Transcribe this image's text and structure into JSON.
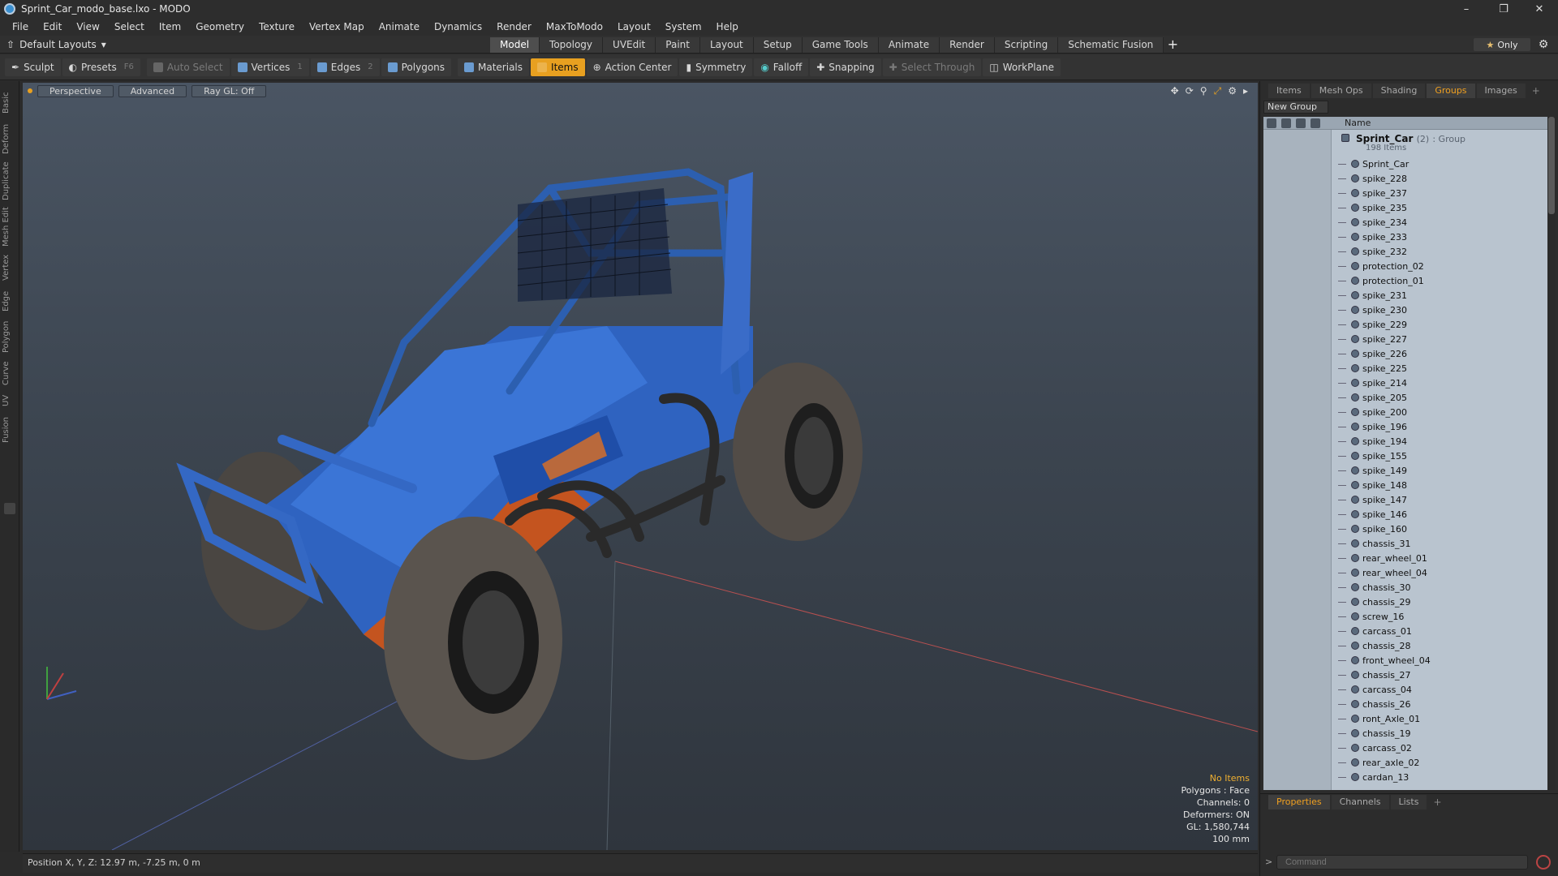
{
  "window": {
    "title": "Sprint_Car_modo_base.lxo - MODO"
  },
  "menu": [
    "File",
    "Edit",
    "View",
    "Select",
    "Item",
    "Geometry",
    "Texture",
    "Vertex Map",
    "Animate",
    "Dynamics",
    "Render",
    "MaxToModo",
    "Layout",
    "System",
    "Help"
  ],
  "layouts": {
    "current": "Default Layouts"
  },
  "layout_tabs": [
    "Model",
    "Topology",
    "UVEdit",
    "Paint",
    "Layout",
    "Setup",
    "Game Tools",
    "Animate",
    "Render",
    "Scripting",
    "Schematic Fusion"
  ],
  "layout_tab_active": "Model",
  "only_label": "Only",
  "toolbar": {
    "sculpt": "Sculpt",
    "presets": "Presets",
    "presets_key": "F6",
    "auto_select": "Auto Select",
    "vertices": "Vertices",
    "vertices_count": "1",
    "edges": "Edges",
    "edges_count": "2",
    "polygons": "Polygons",
    "materials": "Materials",
    "items": "Items",
    "action_center": "Action Center",
    "symmetry": "Symmetry",
    "falloff": "Falloff",
    "snapping": "Snapping",
    "select_through": "Select Through",
    "workplane": "WorkPlane"
  },
  "left_tabs": [
    "Basic",
    "Deform",
    "Duplicate",
    "Mesh Edit",
    "Vertex",
    "Edge",
    "Polygon",
    "Curve",
    "UV",
    "Fusion"
  ],
  "viewport": {
    "view": "Perspective",
    "mode": "Advanced",
    "raygl": "Ray GL: Off",
    "stats": {
      "selection": "No Items",
      "polygons": "Polygons : Face",
      "channels": "Channels: 0",
      "deformers": "Deformers: ON",
      "gl": "GL: 1,580,744",
      "scale": "100 mm"
    }
  },
  "status": {
    "position": "Position X, Y, Z:  12.97 m, -7.25 m, 0 m"
  },
  "right_panel": {
    "tabs": [
      "Items",
      "Mesh Ops",
      "Shading",
      "Groups",
      "Images"
    ],
    "active_tab": "Groups",
    "new_group": "New Group",
    "column_name": "Name",
    "group": {
      "name": "Sprint_Car",
      "count": "(2)",
      "type": ": Group",
      "items": "198 Items"
    },
    "items": [
      "Sprint_Car",
      "spike_228",
      "spike_237",
      "spike_235",
      "spike_234",
      "spike_233",
      "spike_232",
      "protection_02",
      "protection_01",
      "spike_231",
      "spike_230",
      "spike_229",
      "spike_227",
      "spike_226",
      "spike_225",
      "spike_214",
      "spike_205",
      "spike_200",
      "spike_196",
      "spike_194",
      "spike_155",
      "spike_149",
      "spike_148",
      "spike_147",
      "spike_146",
      "spike_160",
      "chassis_31",
      "rear_wheel_01",
      "rear_wheel_04",
      "chassis_30",
      "chassis_29",
      "screw_16",
      "carcass_01",
      "chassis_28",
      "front_wheel_04",
      "chassis_27",
      "carcass_04",
      "chassis_26",
      "ront_Axle_01",
      "chassis_19",
      "carcass_02",
      "rear_axle_02",
      "cardan_13"
    ],
    "bottom_tabs": [
      "Properties",
      "Channels",
      "Lists"
    ],
    "command_placeholder": "Command"
  }
}
